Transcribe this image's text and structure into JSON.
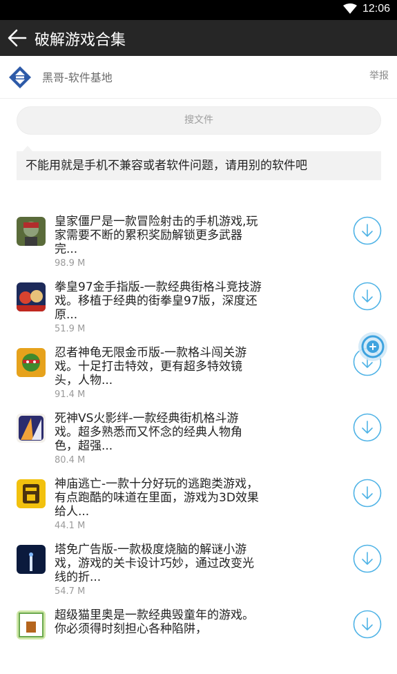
{
  "status": {
    "time": "12:06"
  },
  "appbar": {
    "title": "破解游戏合集"
  },
  "user": {
    "name": "黑哥-软件基地",
    "report": "举报"
  },
  "search": {
    "placeholder": "搜文件"
  },
  "notice": "不能用就是手机不兼容或者软件问题，请用别的软件吧",
  "items": [
    {
      "desc": "皇家僵尸是一款冒险射击的手机游戏,玩家需要不断的累积奖励解锁更多武器完...",
      "size": "98.9 M"
    },
    {
      "desc": "拳皇97金手指版-一款经典街格斗竞技游戏。移植于经典的街拳皇97版，深度还原...",
      "size": "51.9 M"
    },
    {
      "desc": "忍者神龟无限金币版-一款格斗闯关游戏。十足打击特效，更有超多特效镜头，人物...",
      "size": "91.4 M"
    },
    {
      "desc": "死神VS火影绊-一款经典街机格斗游戏。超多熟悉而又怀念的经典人物角色，超强...",
      "size": "80.4 M"
    },
    {
      "desc": "神庙逃亡-一款十分好玩的逃跑类游戏，有点跑酷的味道在里面，游戏为3D效果 给人...",
      "size": "44.1 M"
    },
    {
      "desc": "塔免广告版-一款极度烧脑的解谜小游戏，游戏的关卡设计巧妙，通过改变光线的折...",
      "size": "54.7 M"
    },
    {
      "desc": "超级猫里奥是一款经典毁童年的游戏。你必须得时刻担心各种陷阱，",
      "size": ""
    }
  ]
}
